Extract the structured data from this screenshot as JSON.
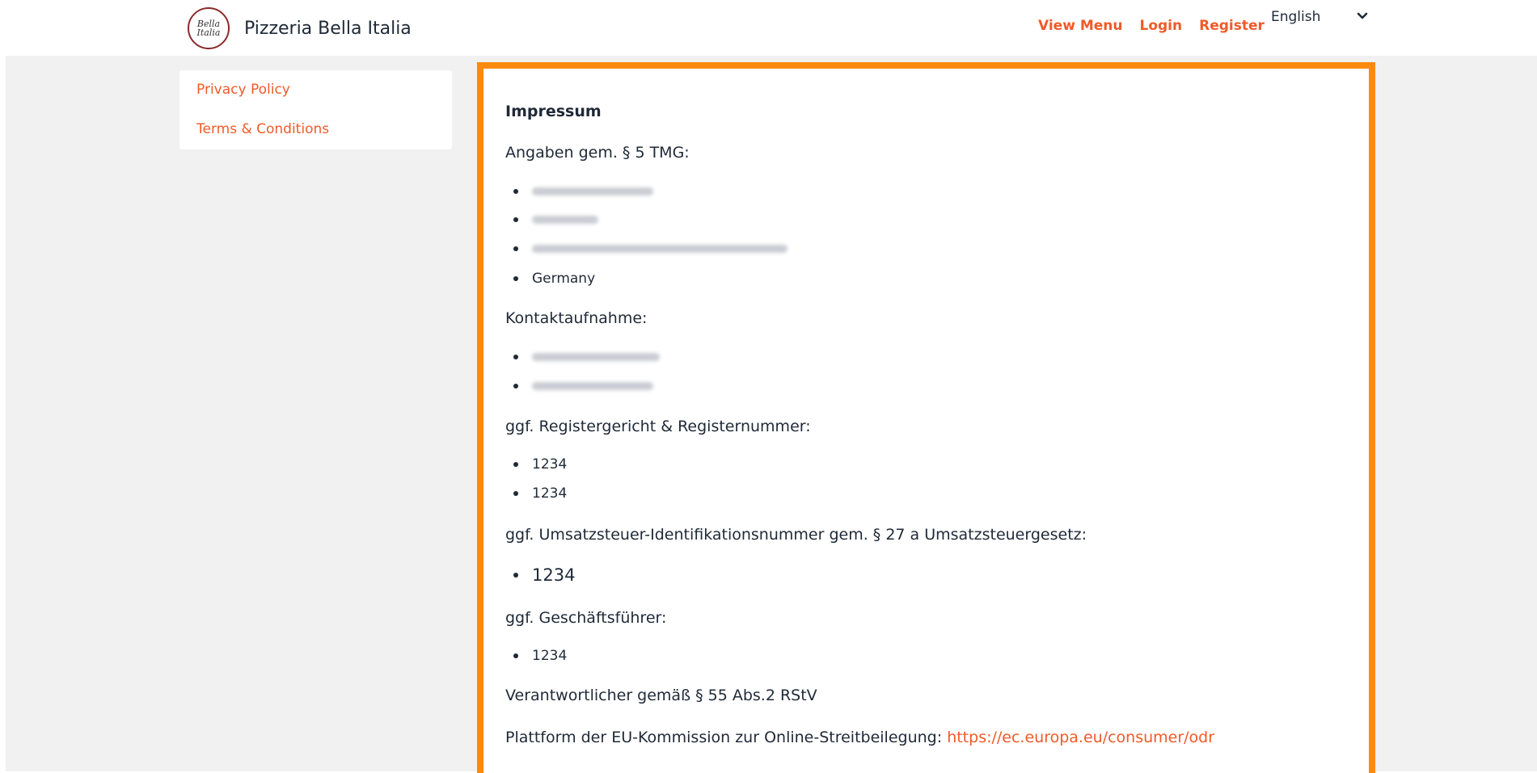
{
  "header": {
    "brand_name": "Pizzeria Bella Italia",
    "logo_text_line1": "Bella",
    "logo_text_line2": "Italia",
    "nav": [
      "View Menu",
      "Login",
      "Register"
    ],
    "language": "English"
  },
  "sidebar": {
    "items": [
      "Privacy Policy",
      "Terms & Conditions"
    ]
  },
  "content": {
    "title": "Impressum",
    "angaben_label": "Angaben gem. § 5 TMG:",
    "angaben_country": "Germany",
    "kontakt_label": "Kontaktaufnahme:",
    "register_label": "ggf. Registergericht & Registernummer:",
    "register_values": [
      "1234",
      "1234"
    ],
    "ust_label": "ggf. Umsatzsteuer-Identifikationsnummer gem. § 27 a Umsatzsteuergesetz:",
    "ust_value": "1234",
    "gf_label": "ggf. Geschäftsführer:",
    "gf_value": "1234",
    "verantwortlich": "Verantwortlicher gemäß § 55 Abs.2 RStV",
    "odr_label": "Plattform der EU-Kommission zur Online-Streitbeilegung:",
    "odr_link": "https://ec.europa.eu/consumer/odr"
  },
  "colors": {
    "accent": "#f05a28",
    "highlight_border": "#fb8a0f",
    "background": "#f1f1f1"
  }
}
